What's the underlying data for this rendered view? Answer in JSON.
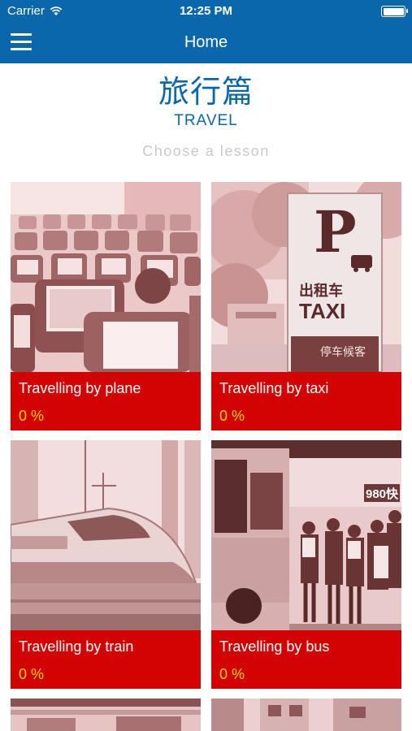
{
  "status_bar": {
    "carrier": "Carrier",
    "time": "12:25 PM"
  },
  "nav": {
    "title": "Home"
  },
  "header": {
    "chinese_title": "旅行篇",
    "english_title": "TRAVEL",
    "subtitle": "Choose a lesson"
  },
  "lessons": [
    {
      "title": "Travelling by plane",
      "progress": "0 %"
    },
    {
      "title": "Travelling by taxi",
      "progress": "0 %"
    },
    {
      "title": "Travelling by train",
      "progress": "0 %"
    },
    {
      "title": "Travelling by bus",
      "progress": "0 %"
    }
  ],
  "taxi_sign": {
    "letter": "P",
    "chinese": "出租车",
    "english": "TAXI",
    "waiting": "停车候客"
  },
  "bus_sign": {
    "route": "980快"
  },
  "colors": {
    "brand_blue": "#0a67aa",
    "card_red": "#d10303",
    "progress_yellow": "#ffd400",
    "photo_tint": "#f2d2d2"
  }
}
